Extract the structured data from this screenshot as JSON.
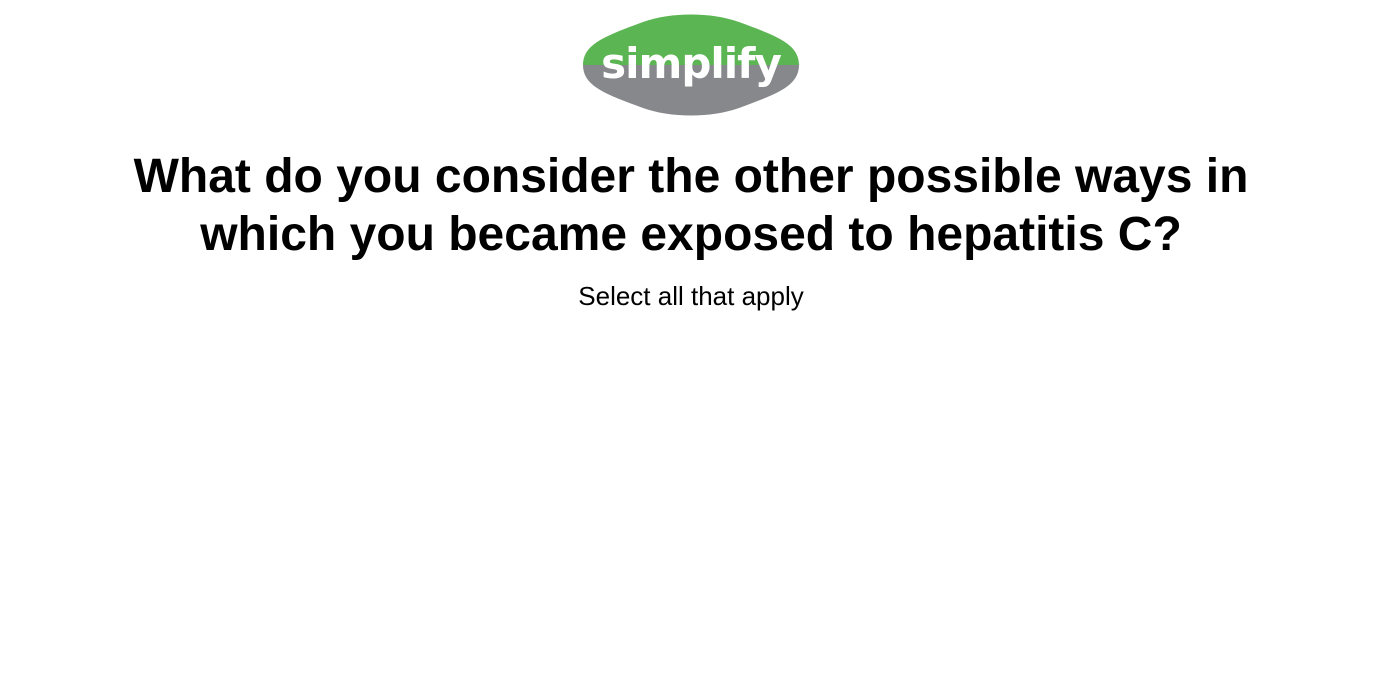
{
  "brand": {
    "logo_text": "simplify",
    "green": "#5bb552",
    "gray": "#87888c"
  },
  "question": {
    "title": "What do you consider the other possible ways in which you became exposed to hepatitis C?",
    "instruction": "Select all that apply"
  }
}
